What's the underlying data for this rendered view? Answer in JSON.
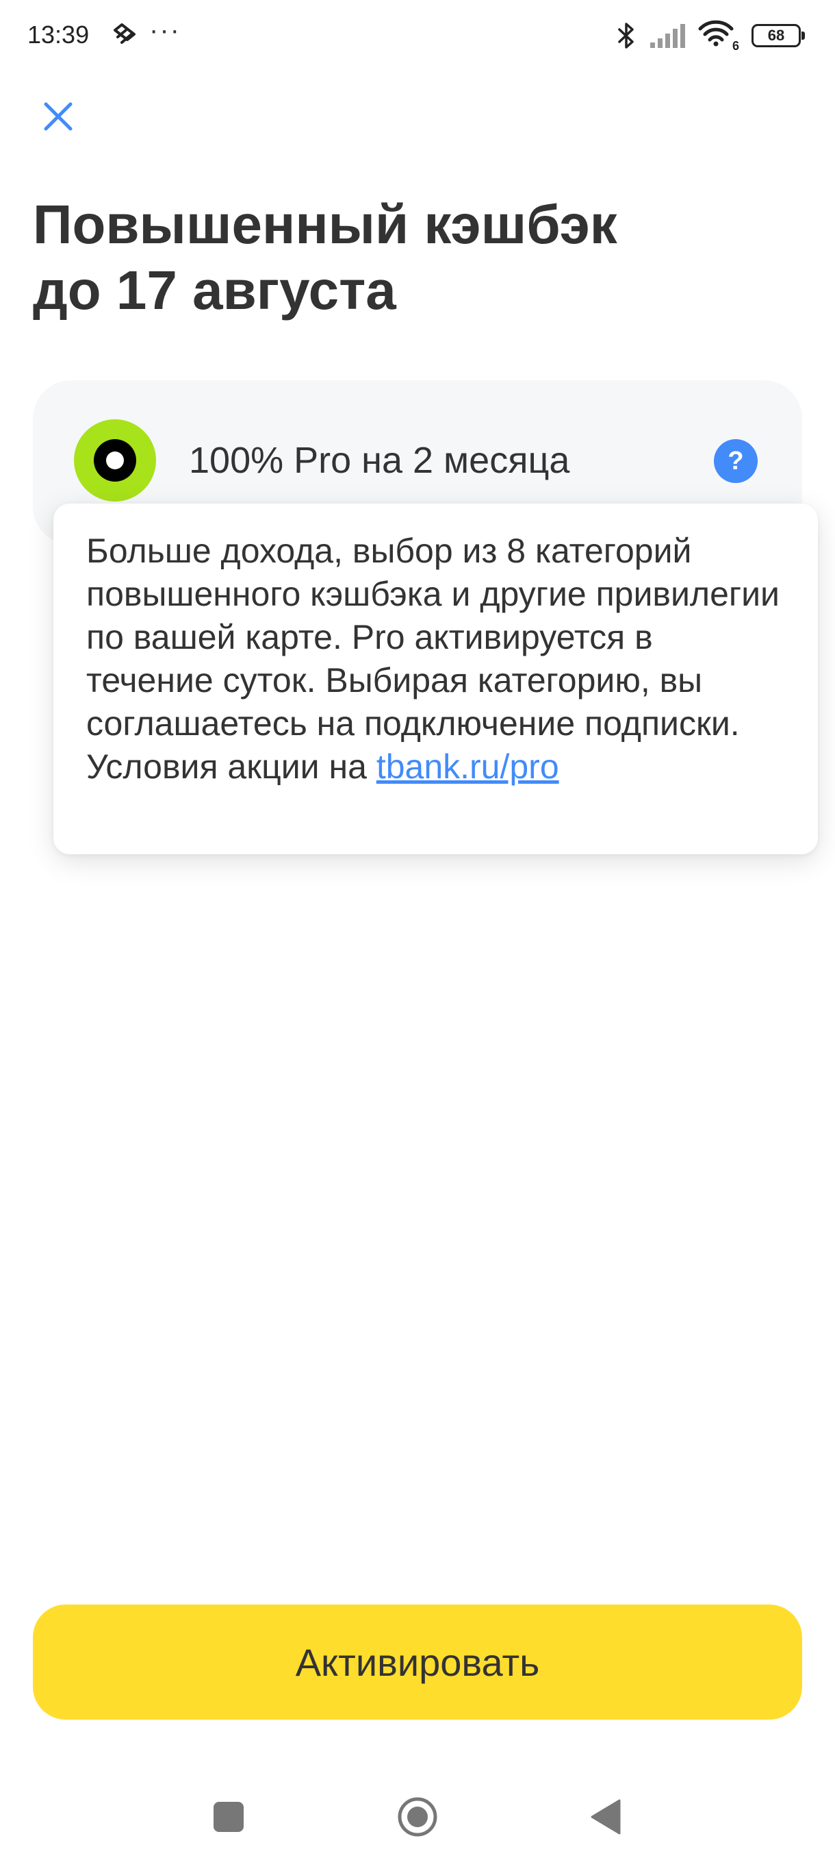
{
  "status_bar": {
    "time": "13:39",
    "dots": "···",
    "battery": "68",
    "network_label": "6"
  },
  "header": {
    "title_line1": "Повышенный кэшбэк",
    "title_line2": "до 17 августа"
  },
  "option": {
    "label": "100% Pro на 2 месяца",
    "help_label": "?",
    "selected": true
  },
  "tooltip": {
    "text": "Больше дохода, выбор из 8 категорий повышенного кэшбэка и другие привилегии по вашей карте. Pro активируется в течение суток. Выбирая категорию, вы соглашаетесь на подключение подписки. Условия акции на ",
    "link_text": "tbank.ru/pro"
  },
  "footer": {
    "activate_label": "Активировать"
  },
  "colors": {
    "accent_yellow": "#ffdd2d",
    "accent_blue": "#428bf9",
    "radio_green": "#a8e21a",
    "card_bg": "#f6f7f8",
    "text": "#333333"
  },
  "icons": {
    "close": "close-icon",
    "help": "question-icon",
    "bluetooth": "bluetooth-icon",
    "signal": "signal-icon",
    "wifi": "wifi-icon",
    "battery": "battery-icon",
    "nav_recent": "square-icon",
    "nav_home": "circle-icon",
    "nav_back": "triangle-back-icon"
  }
}
